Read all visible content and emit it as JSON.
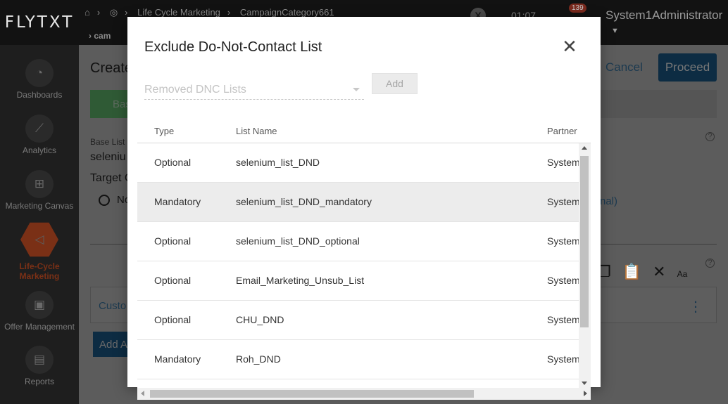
{
  "app": {
    "logo": "FLYTXT",
    "breadcrumb": [
      "Life Cycle Marketing",
      "CampaignCategory661"
    ],
    "breadcrumb_row2": "cam",
    "time": "01:07",
    "notification_count": "139",
    "user": "System1Administrator"
  },
  "sidebar": {
    "items": [
      {
        "label": "Dashboards",
        "icon": "gauge-icon"
      },
      {
        "label": "Analytics",
        "icon": "line-chart-icon"
      },
      {
        "label": "Marketing Canvas",
        "icon": "canvas-icon"
      },
      {
        "label": "Life-Cycle Marketing",
        "icon": "megaphone-icon"
      },
      {
        "label": "Offer Management",
        "icon": "gift-icon"
      },
      {
        "label": "Reports",
        "icon": "report-icon"
      }
    ]
  },
  "main": {
    "title": "Create",
    "cancel_label": "Cancel",
    "proceed_label": "Proceed",
    "green_tab_label": "Bas",
    "base_list_label": "Base List",
    "base_list_value": "seleniu",
    "target_label": "Target C",
    "radio_label": "No",
    "optional_link": "nal)",
    "custom_label": "Custo",
    "add_label": "Add A"
  },
  "modal": {
    "title": "Exclude Do-Not-Contact List",
    "select_placeholder": "Removed DNC Lists",
    "add_label": "Add",
    "columns": {
      "type": "Type",
      "name": "List Name",
      "partner": "Partner"
    },
    "rows": [
      {
        "type": "Optional",
        "name": "selenium_list_DND",
        "partner": "System"
      },
      {
        "type": "Mandatory",
        "name": "selenium_list_DND_mandatory",
        "partner": "System"
      },
      {
        "type": "Optional",
        "name": "selenium_list_DND_optional",
        "partner": "System"
      },
      {
        "type": "Optional",
        "name": "Email_Marketing_Unsub_List",
        "partner": "System"
      },
      {
        "type": "Optional",
        "name": "CHU_DND",
        "partner": "System"
      },
      {
        "type": "Mandatory",
        "name": "Roh_DND",
        "partner": "System"
      },
      {
        "type": "",
        "name": "",
        "partner": ""
      }
    ]
  }
}
